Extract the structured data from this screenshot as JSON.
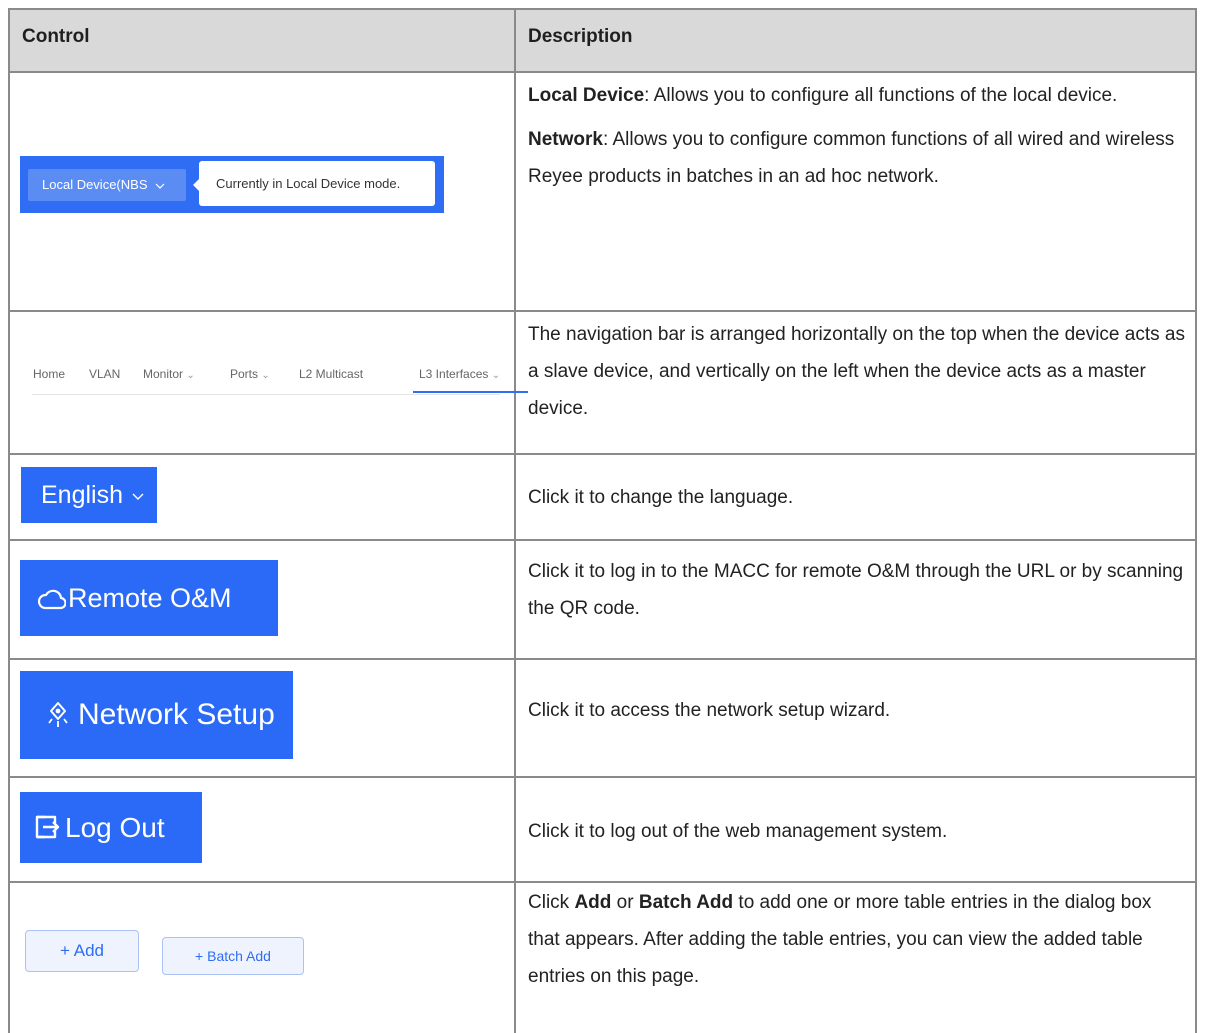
{
  "header": {
    "control": "Control",
    "description": "Description"
  },
  "rows": [
    {
      "control": {
        "button_label": "Local Device(NBS",
        "tooltip": "Currently in Local Device mode."
      },
      "desc": [
        {
          "term": "Local Device",
          "text": ": Allows you to configure all functions of the local device."
        },
        {
          "term": "Network",
          "text": ": Allows you to configure common functions of all wired and wireless Reyee products in batches in an ad hoc network."
        }
      ]
    },
    {
      "control": {
        "nav_items": [
          "Home",
          "VLAN",
          "Monitor",
          "Ports",
          "L2 Multicast",
          "L3 Interfaces"
        ]
      },
      "desc": "The navigation bar is arranged horizontally on the top when the device acts as a slave device, and vertically on the left when the device acts as a master device."
    },
    {
      "control": {
        "label": "English"
      },
      "desc": "Click it to change the language."
    },
    {
      "control": {
        "label": "Remote O&M"
      },
      "desc": "Click it to log in to the MACC for remote O&M through the URL or by scanning the QR code."
    },
    {
      "control": {
        "label": "Network Setup"
      },
      "desc": "Click it to access the network setup wizard."
    },
    {
      "control": {
        "label": "Log Out"
      },
      "desc": "Click it to log out of the web management system."
    },
    {
      "control": {
        "add": "+ Add",
        "batch_add": "+ Batch Add"
      },
      "desc": {
        "p1": "Click ",
        "b1": "Add",
        "p2": " or ",
        "b2": "Batch Add",
        "p3": " to add one or more table entries in the dialog box that appears. After adding the table entries, you can view the added table entries on this page."
      }
    }
  ],
  "colors": {
    "accent": "#2a6af6",
    "header_bg": "#d9d9d9",
    "border": "#8a8a8a"
  },
  "icons": {
    "remote": "cloud-icon",
    "network_setup": "rocket-icon",
    "log_out": "logout-icon",
    "dropdown": "chevron-down-icon"
  }
}
